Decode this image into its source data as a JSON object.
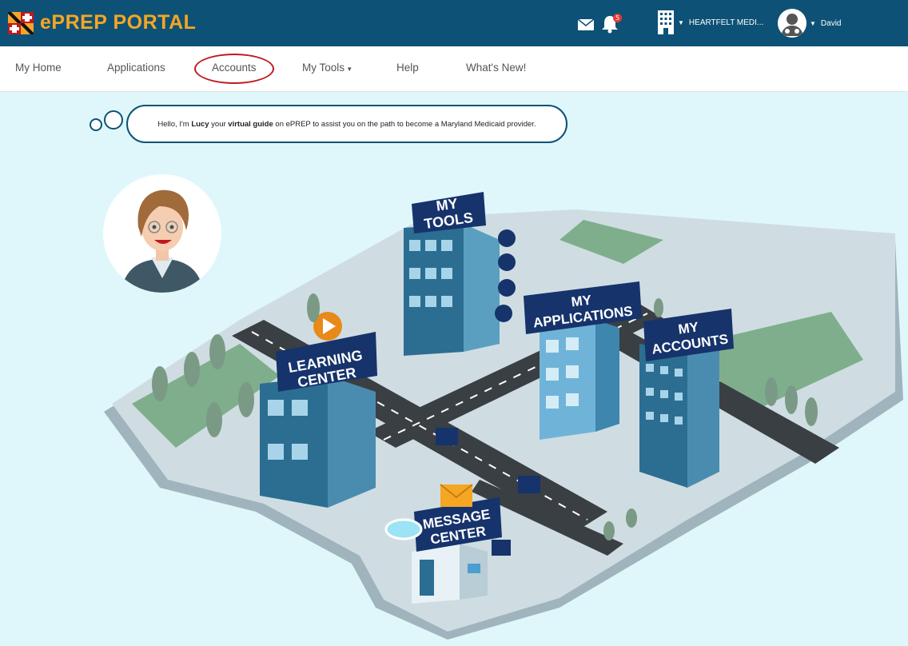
{
  "header": {
    "logo_text": "ePREP PORTAL",
    "notifications_count": "5",
    "organization_label": "HEARTFELT MEDI...",
    "user_label": "David",
    "icons": [
      "envelope-icon",
      "bell-icon",
      "building-icon",
      "user-avatar-icon"
    ]
  },
  "nav": {
    "items": [
      {
        "label": "My Home"
      },
      {
        "label": "Applications"
      },
      {
        "label": "Accounts"
      },
      {
        "label": "My Tools"
      },
      {
        "label": "Help"
      },
      {
        "label": "What's New!"
      }
    ],
    "highlighted": "Accounts"
  },
  "guide": {
    "greeting_pre": "Hello, I'm ",
    "name": "Lucy",
    "greeting_mid": " your ",
    "role": "virtual guide",
    "greeting_post": " on ePREP to assist you on the path to become a Maryland Medicaid provider."
  },
  "city": {
    "buildings": [
      {
        "line1": "MY",
        "line2": "TOOLS"
      },
      {
        "line1": "MY",
        "line2": "APPLICATIONS"
      },
      {
        "line1": "MY",
        "line2": "ACCOUNTS"
      },
      {
        "line1": "LEARNING",
        "line2": "CENTER"
      },
      {
        "line1": "MESSAGE",
        "line2": "CENTER"
      }
    ]
  },
  "colors": {
    "header_bg": "#0d5276",
    "logo": "#f5a623",
    "background": "#dff7fb",
    "highlight_ring": "#c0191f",
    "sign": "#16336b"
  }
}
